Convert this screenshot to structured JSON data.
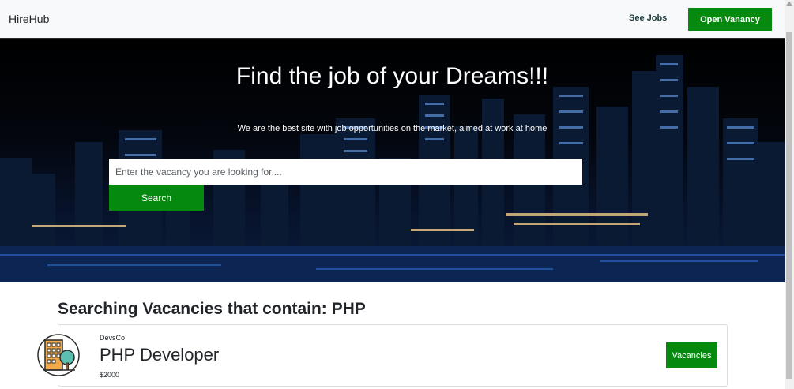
{
  "navbar": {
    "brand": "HireHub",
    "see_jobs": "See Jobs",
    "open_vacancy": "Open Vanancy"
  },
  "hero": {
    "title": "Find the job of your Dreams!!!",
    "subtitle": "We are the best site with job opportunities on the market, aimed at work at home",
    "search_placeholder": "Enter the vacancy you are looking for....",
    "search_button": "Search"
  },
  "results": {
    "heading": "Searching Vacancies that contain: PHP",
    "items": [
      {
        "company": "DevsCo",
        "title": "PHP Developer",
        "salary": "$2000",
        "button": "Vacancies",
        "logo_icon": "building-tree-icon"
      }
    ]
  },
  "colors": {
    "accent": "#058a0f",
    "navbar_bg": "#f8f9fa"
  }
}
